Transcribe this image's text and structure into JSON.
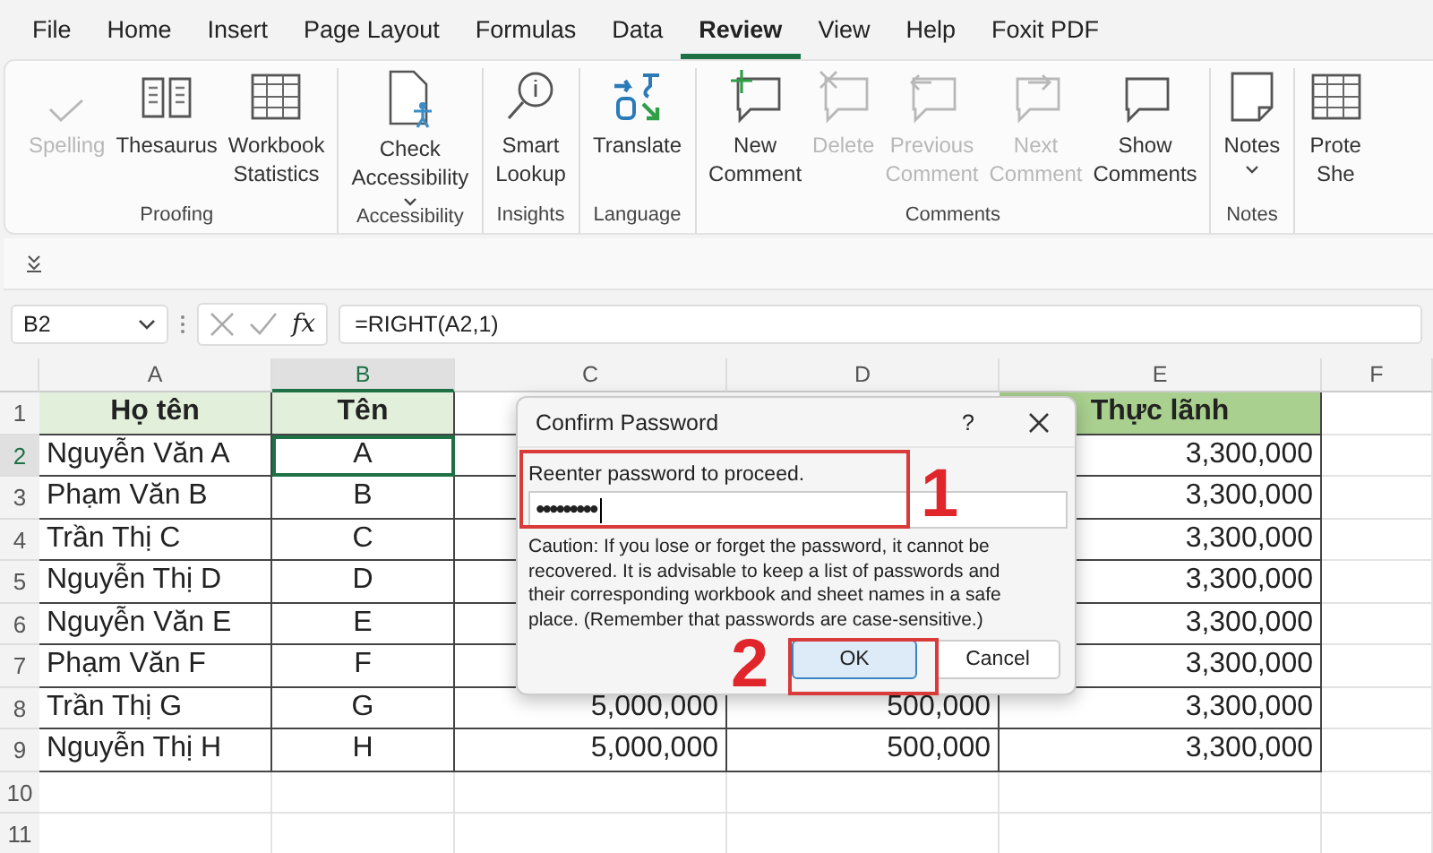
{
  "tabs": [
    {
      "label": "File",
      "selected": false
    },
    {
      "label": "Home",
      "selected": false
    },
    {
      "label": "Insert",
      "selected": false
    },
    {
      "label": "Page Layout",
      "selected": false
    },
    {
      "label": "Formulas",
      "selected": false
    },
    {
      "label": "Data",
      "selected": false
    },
    {
      "label": "Review",
      "selected": true
    },
    {
      "label": "View",
      "selected": false
    },
    {
      "label": "Help",
      "selected": false
    },
    {
      "label": "Foxit PDF",
      "selected": false
    }
  ],
  "ribbon": {
    "groups": [
      {
        "label": "Proofing",
        "items": [
          {
            "kind": "spelling",
            "lines": [
              "Spelling"
            ],
            "disabled": true,
            "dropdown": false
          },
          {
            "kind": "book",
            "lines": [
              "Thesaurus"
            ],
            "disabled": false,
            "dropdown": false
          },
          {
            "kind": "table",
            "lines": [
              "Workbook",
              "Statistics"
            ],
            "disabled": false,
            "dropdown": false
          }
        ]
      },
      {
        "label": "Accessibility",
        "items": [
          {
            "kind": "document",
            "lines": [
              "Check",
              "Accessibility"
            ],
            "disabled": false,
            "dropdown": true
          }
        ]
      },
      {
        "label": "Insights",
        "items": [
          {
            "kind": "lookup",
            "lines": [
              "Smart",
              "Lookup"
            ],
            "disabled": false,
            "dropdown": false
          }
        ]
      },
      {
        "label": "Language",
        "items": [
          {
            "kind": "translate",
            "lines": [
              "Translate"
            ],
            "disabled": false,
            "dropdown": false
          }
        ]
      },
      {
        "label": "Comments",
        "items": [
          {
            "kind": "comment-new",
            "lines": [
              "New",
              "Comment"
            ],
            "disabled": false,
            "dropdown": false
          },
          {
            "kind": "comment-delete",
            "lines": [
              "Delete"
            ],
            "disabled": true,
            "dropdown": false
          },
          {
            "kind": "comment-prev",
            "lines": [
              "Previous",
              "Comment"
            ],
            "disabled": true,
            "dropdown": false
          },
          {
            "kind": "comment-next",
            "lines": [
              "Next",
              "Comment"
            ],
            "disabled": true,
            "dropdown": false
          },
          {
            "kind": "comment",
            "lines": [
              "Show",
              "Comments"
            ],
            "disabled": false,
            "dropdown": false
          }
        ]
      },
      {
        "label": "Notes",
        "items": [
          {
            "kind": "note",
            "lines": [
              "Notes"
            ],
            "disabled": false,
            "dropdown": true
          }
        ]
      },
      {
        "items": [
          {
            "kind": "table",
            "lines": [
              "Prote",
              "She"
            ],
            "disabled": false,
            "dropdown": false
          }
        ]
      }
    ]
  },
  "formula_bar": {
    "name_box": "B2",
    "fx": "fx",
    "formula": "=RIGHT(A2,1)"
  },
  "sheet": {
    "columns": [
      {
        "label": "A",
        "selected": false
      },
      {
        "label": "B",
        "selected": true
      },
      {
        "label": "C",
        "selected": false
      },
      {
        "label": "D",
        "selected": false
      },
      {
        "label": "E",
        "selected": false
      },
      {
        "label": "F",
        "selected": false
      }
    ],
    "rows": [
      {
        "num": "1",
        "kind": "header",
        "selected": false,
        "a": {
          "text": "Họ tên",
          "color": "#e2efda"
        },
        "b": {
          "text": "Tên",
          "color": "#e2efda"
        },
        "e": {
          "text": "Thực lãnh",
          "color": "#a9d08e"
        }
      },
      {
        "num": "2",
        "kind": "data",
        "selected": true,
        "a": "Nguyễn Văn A",
        "b": "A",
        "e": "3,300,000"
      },
      {
        "num": "3",
        "kind": "data",
        "selected": false,
        "a": "Phạm Văn B",
        "b": "B",
        "e": "3,300,000"
      },
      {
        "num": "4",
        "kind": "data",
        "selected": false,
        "a": "Trần Thị C",
        "b": "C",
        "e": "3,300,000"
      },
      {
        "num": "5",
        "kind": "data",
        "selected": false,
        "a": "Nguyễn Thị D",
        "b": "D",
        "e": "3,300,000"
      },
      {
        "num": "6",
        "kind": "data",
        "selected": false,
        "a": "Nguyễn Văn E",
        "b": "E",
        "e": "3,300,000"
      },
      {
        "num": "7",
        "kind": "data",
        "selected": false,
        "a": "Phạm Văn F",
        "b": "F",
        "e": "3,300,000"
      },
      {
        "num": "8",
        "kind": "data",
        "selected": false,
        "a": "Trần Thị G",
        "b": "G",
        "c": "5,000,000",
        "d": "500,000",
        "e": "3,300,000"
      },
      {
        "num": "9",
        "kind": "data",
        "selected": false,
        "a": "Nguyễn Thị H",
        "b": "H",
        "c": "5,000,000",
        "d": "500,000",
        "e": "3,300,000"
      },
      {
        "num": "10",
        "kind": "empty",
        "selected": false
      },
      {
        "num": "11",
        "kind": "empty",
        "selected": false
      }
    ]
  },
  "dialog": {
    "title": "Confirm Password",
    "help": "?",
    "prompt": "Reenter password to proceed.",
    "password": "•••••••••",
    "caution": "Caution: If you lose or forget the password, it cannot be recovered. It is advisable to keep a list of passwords and their corresponding workbook and sheet names in a safe place. (Remember that passwords are case-sensitive.)",
    "buttons": [
      {
        "label": "OK",
        "default": true
      },
      {
        "label": "Cancel",
        "default": false
      }
    ]
  },
  "annotations": [
    "1",
    "2"
  ]
}
